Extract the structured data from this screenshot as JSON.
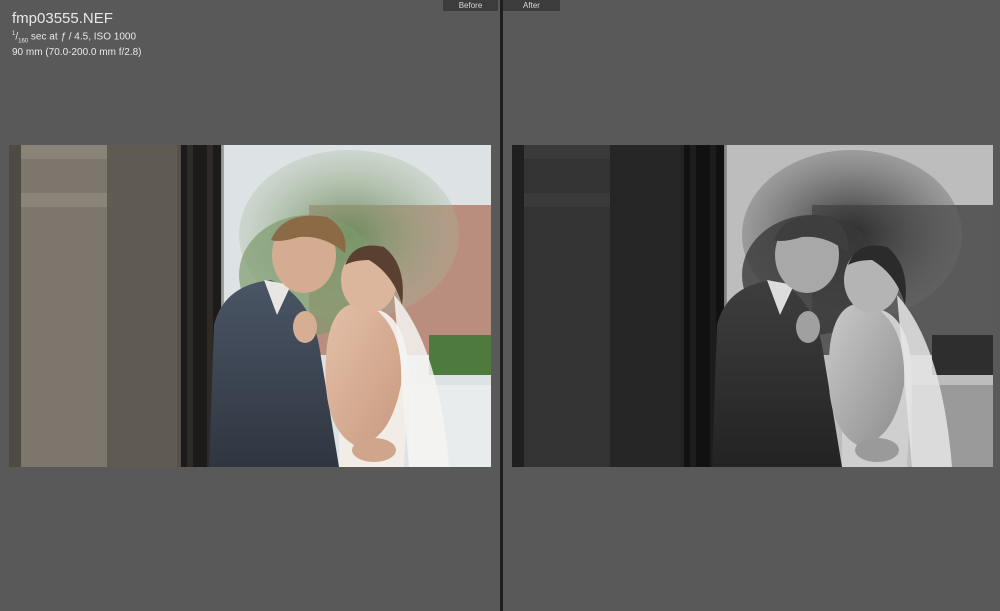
{
  "compare_view": {
    "before_label": "Before",
    "after_label": "After"
  },
  "photo_info": {
    "filename": "fmp03555.NEF",
    "shutter_numerator": "1",
    "shutter_denominator": "160",
    "exposure_rest": "sec at",
    "aperture_symbol": "ƒ",
    "aperture_and_iso": "/ 4.5, ISO 1000",
    "lens": "90 mm (70.0-200.0 mm f/2.8)"
  },
  "images": {
    "before": {
      "icon": "wedding-couple-photo",
      "tone": "color"
    },
    "after": {
      "icon": "wedding-couple-photo",
      "tone": "black-and-white"
    }
  },
  "colors": {
    "background": "#595959",
    "divider": "#1e1e1e",
    "tab_background": "#3c3c3c"
  }
}
